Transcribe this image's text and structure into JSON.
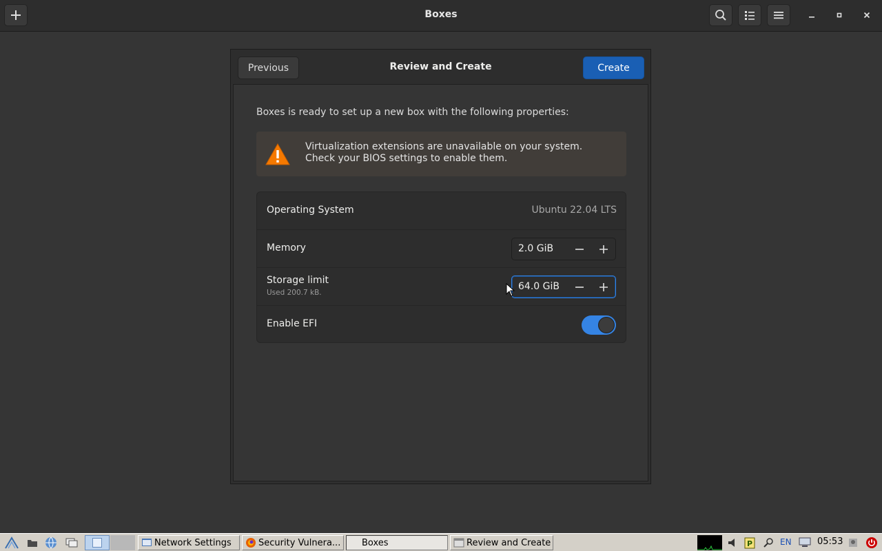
{
  "window": {
    "title": "Boxes"
  },
  "dialog": {
    "title": "Review and Create",
    "previous_label": "Previous",
    "create_label": "Create",
    "intro": "Boxes is ready to set up a new box with the following properties:",
    "warning": {
      "line1": "Virtualization extensions are unavailable on your system.",
      "line2": "Check your BIOS settings to enable them."
    },
    "properties": {
      "os_label": "Operating System",
      "os_value": "Ubuntu 22.04 LTS",
      "memory_label": "Memory",
      "memory_value": "2.0 GiB",
      "storage_label": "Storage limit",
      "storage_sub": "Used 200.7 kB.",
      "storage_value": "64.0 GiB",
      "efi_label": "Enable EFI",
      "efi_enabled": true
    }
  },
  "taskbar": {
    "tasks": [
      {
        "label": "Network Settings"
      },
      {
        "label": "Security Vulnera..."
      },
      {
        "label": "Boxes"
      },
      {
        "label": "Review and Create"
      }
    ],
    "language": "EN",
    "clock": "05:53"
  },
  "colors": {
    "accent": "#3584e4",
    "create_button": "#1a5fb4",
    "warning_icon": "#f57900",
    "power_icon": "#cc0000"
  }
}
